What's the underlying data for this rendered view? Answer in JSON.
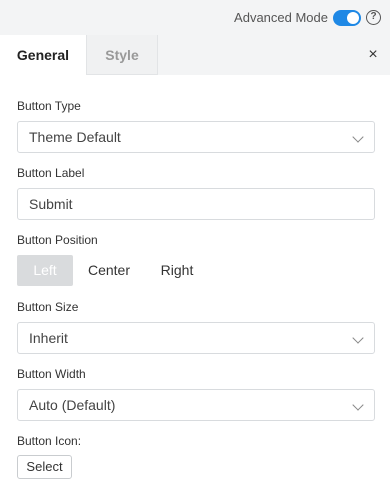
{
  "header": {
    "advanced_mode_label": "Advanced Mode",
    "advanced_mode_on": true,
    "help_glyph": "?"
  },
  "tabs": [
    {
      "label": "General",
      "active": true
    },
    {
      "label": "Style",
      "active": false
    }
  ],
  "close_glyph": "×",
  "fields": {
    "button_type": {
      "label": "Button Type",
      "value": "Theme Default"
    },
    "button_label": {
      "label": "Button Label",
      "value": "Submit"
    },
    "button_position": {
      "label": "Button Position",
      "options": [
        "Left",
        "Center",
        "Right"
      ],
      "selected": "Left"
    },
    "button_size": {
      "label": "Button Size",
      "value": "Inherit"
    },
    "button_width": {
      "label": "Button Width",
      "value": "Auto (Default)"
    },
    "button_icon": {
      "label": "Button Icon:",
      "action": "Select"
    }
  },
  "colors": {
    "accent": "#1e88e5",
    "segment_selected_bg": "#d9dbdd"
  }
}
